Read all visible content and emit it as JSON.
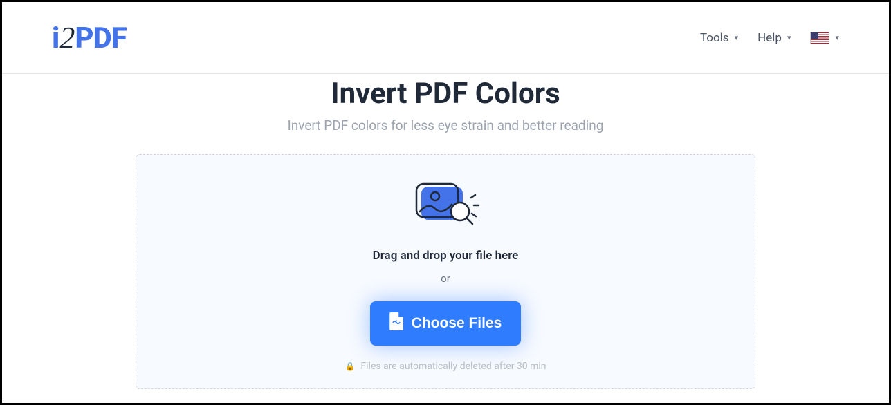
{
  "logo": {
    "part1": "i",
    "part2": "2",
    "part3": "PDF"
  },
  "nav": {
    "tools": "Tools",
    "help": "Help"
  },
  "page": {
    "title": "Invert PDF Colors",
    "subtitle": "Invert PDF colors for less eye strain and better reading"
  },
  "dropzone": {
    "drag_text": "Drag and drop your file here",
    "or_text": "or",
    "choose_button": "Choose Files",
    "auto_delete": "Files are automatically deleted after 30 min"
  }
}
